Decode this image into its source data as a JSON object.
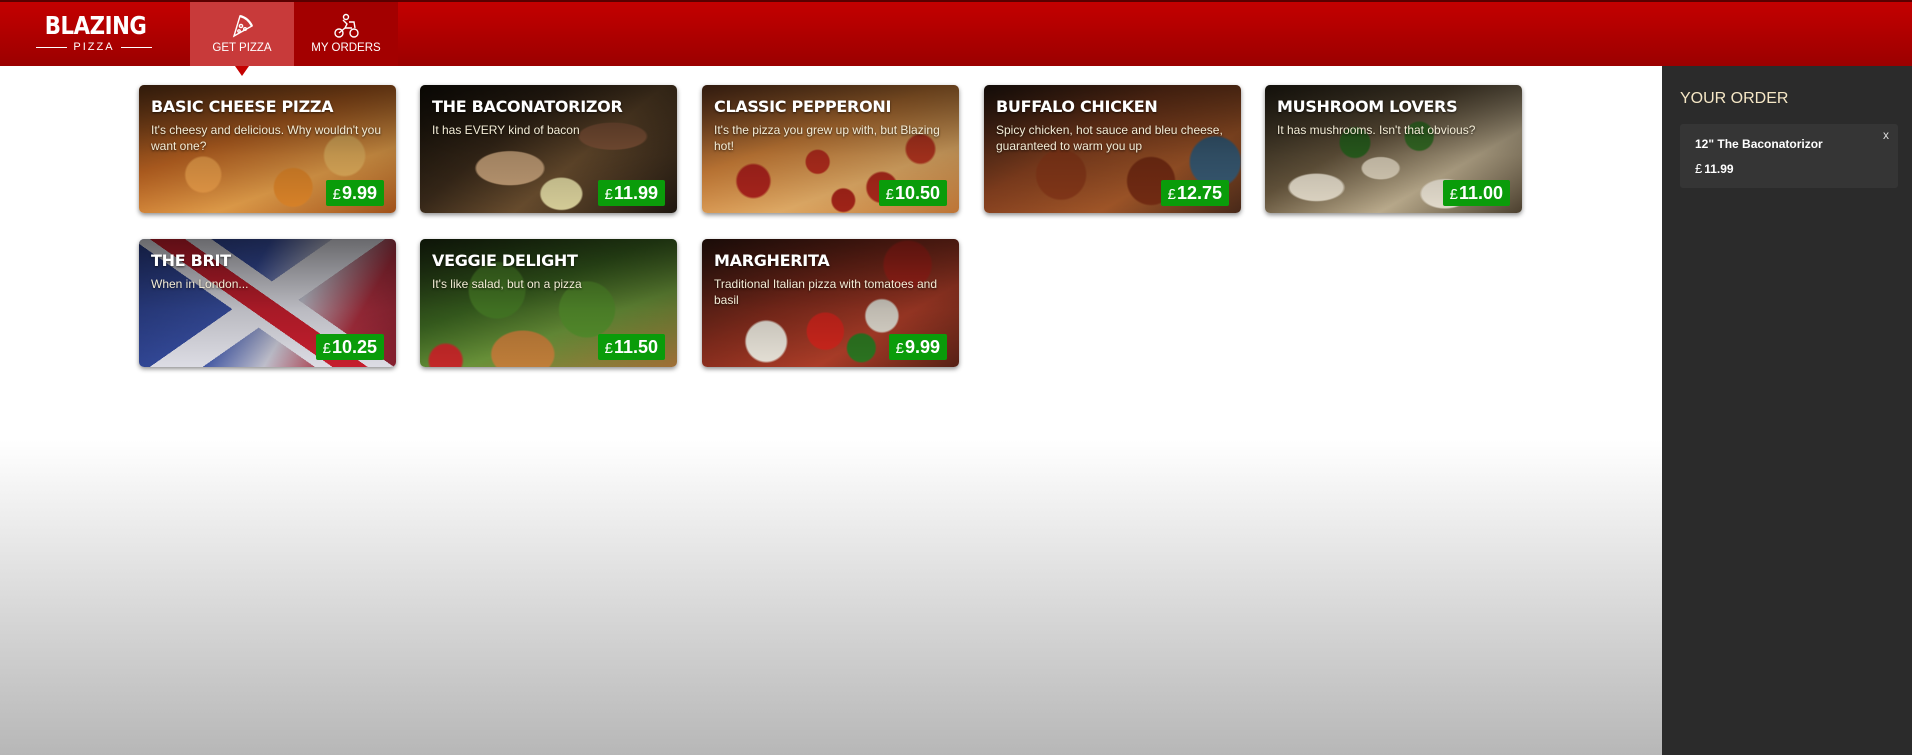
{
  "brand": {
    "name_top": "BLAZING",
    "name_bottom": "PIZZA"
  },
  "nav": {
    "tabs": [
      {
        "label": "GET PIZZA",
        "icon": "pizza-slice-icon",
        "active": true
      },
      {
        "label": "MY ORDERS",
        "icon": "scooter-icon",
        "active": false
      }
    ]
  },
  "currency_symbol": "£",
  "specials": [
    {
      "title": "BASIC CHEESE PIZZA",
      "description": "It's cheesy and delicious. Why wouldn't you want one?",
      "price": "9.99"
    },
    {
      "title": "THE BACONATORIZOR",
      "description": "It has EVERY kind of bacon",
      "price": "11.99"
    },
    {
      "title": "CLASSIC PEPPERONI",
      "description": "It's the pizza you grew up with, but Blazing hot!",
      "price": "10.50"
    },
    {
      "title": "BUFFALO CHICKEN",
      "description": "Spicy chicken, hot sauce and bleu cheese, guaranteed to warm you up",
      "price": "12.75"
    },
    {
      "title": "MUSHROOM LOVERS",
      "description": "It has mushrooms. Isn't that obvious?",
      "price": "11.00"
    },
    {
      "title": "THE BRIT",
      "description": "When in London...",
      "price": "10.25"
    },
    {
      "title": "VEGGIE DELIGHT",
      "description": "It's like salad, but on a pizza",
      "price": "11.50"
    },
    {
      "title": "MARGHERITA",
      "description": "Traditional Italian pizza with tomatoes and basil",
      "price": "9.99"
    }
  ],
  "order": {
    "heading": "YOUR ORDER",
    "items": [
      {
        "name": "12\" The Baconatorizor",
        "price": "11.99",
        "remove_label": "x"
      }
    ]
  },
  "colors": {
    "header_red": "#c40000",
    "price_green": "#0a9c0a",
    "sidebar_bg": "#2b2b2b",
    "sidebar_heading": "#f5e7c6"
  }
}
